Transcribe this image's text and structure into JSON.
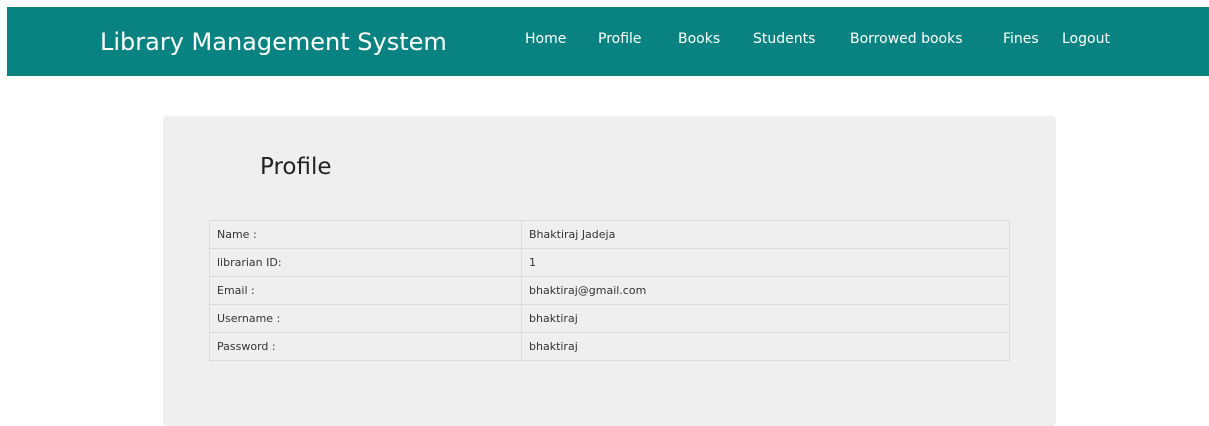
{
  "header": {
    "brand": "Library Management System",
    "nav": [
      "Home",
      "Profile",
      "Books",
      "Students",
      "Borrowed books",
      "Fines",
      "Logout"
    ],
    "color": "#088381"
  },
  "page": {
    "title": "Profile"
  },
  "profile": {
    "rows": [
      {
        "label": "Name :",
        "value": "Bhaktiraj Jadeja"
      },
      {
        "label": "librarian ID:",
        "value": "1"
      },
      {
        "label": "Email :",
        "value": "bhaktiraj@gmail.com"
      },
      {
        "label": "Username :",
        "value": "bhaktiraj"
      },
      {
        "label": "Password :",
        "value": "bhaktiraj"
      }
    ]
  }
}
